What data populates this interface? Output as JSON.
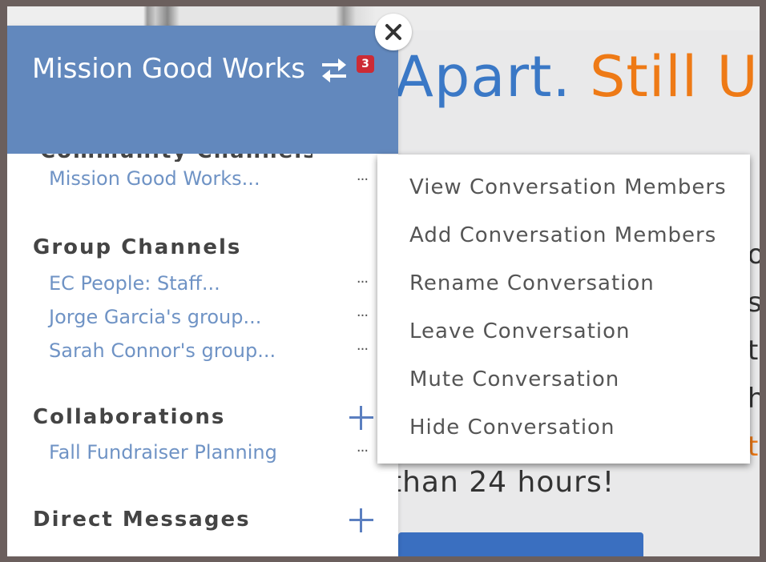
{
  "hero": {
    "headline_part1": "Apart.",
    "headline_part2": "Still Ur",
    "subtext": "than 24 hours!",
    "side_letters": [
      "o",
      "s",
      "t",
      "h",
      "t"
    ]
  },
  "sidebar": {
    "title": "Mission Good Works",
    "notification_count": "3",
    "cutoff_section": "Community Channels",
    "top_channel": "Mission Good Works...",
    "group_channels": {
      "title": "Group Channels",
      "items": [
        "EC People: Staff...",
        "Jorge Garcia's group...",
        "Sarah Connor's group..."
      ]
    },
    "collaborations": {
      "title": "Collaborations",
      "items": [
        "Fall Fundraiser Planning"
      ]
    },
    "direct_messages": {
      "title": "Direct Messages"
    },
    "more_label": "···"
  },
  "context_menu": {
    "items": [
      "View Conversation Members",
      "Add Conversation Members",
      "Rename Conversation",
      "Leave Conversation",
      "Mute Conversation",
      "Hide Conversation"
    ]
  },
  "colors": {
    "header_blue": "#6288bd",
    "link_blue": "#6f93c5",
    "badge_red": "#cc2b35",
    "accent_orange": "#ee7a16"
  },
  "icons": {
    "switch": "swap-arrows-icon",
    "close": "close-icon",
    "add": "plus-icon",
    "more": "ellipsis-icon"
  }
}
